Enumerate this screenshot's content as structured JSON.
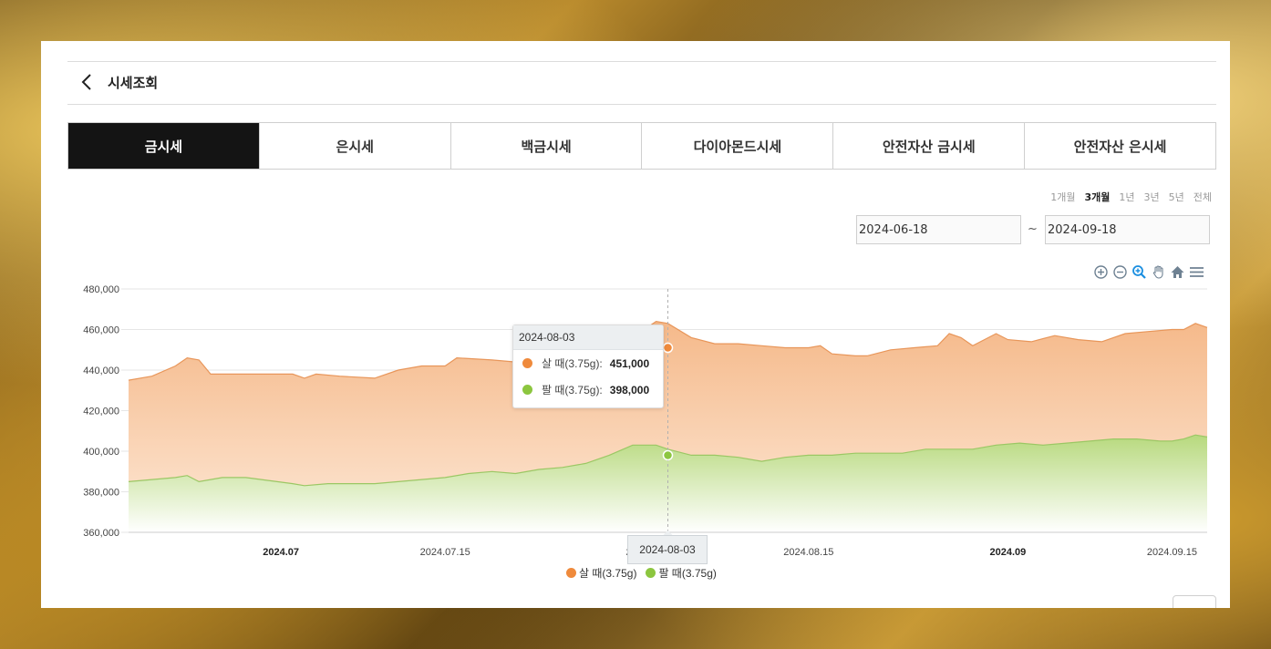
{
  "header": {
    "title": "시세조회"
  },
  "tabs": [
    {
      "label": "금시세",
      "active": true
    },
    {
      "label": "은시세",
      "active": false
    },
    {
      "label": "백금시세",
      "active": false
    },
    {
      "label": "다이아몬드시세",
      "active": false
    },
    {
      "label": "안전자산 금시세",
      "active": false
    },
    {
      "label": "안전자산 은시세",
      "active": false
    }
  ],
  "periods": [
    {
      "label": "1개월",
      "active": false
    },
    {
      "label": "3개월",
      "active": true
    },
    {
      "label": "1년",
      "active": false
    },
    {
      "label": "3년",
      "active": false
    },
    {
      "label": "5년",
      "active": false
    },
    {
      "label": "전체",
      "active": false
    }
  ],
  "date_range": {
    "start": "2024-06-18",
    "separator": "~",
    "end": "2024-09-18"
  },
  "toolbar_icons": [
    "zoom-in-icon",
    "zoom-out-icon",
    "selection-zoom-icon",
    "pan-hand-icon",
    "home-reset-icon",
    "menu-icon"
  ],
  "colors": {
    "buy": "#ef8a3c",
    "sell": "#8cc63f",
    "active_tab": "#141414"
  },
  "tooltip": {
    "date": "2024-08-03",
    "rows": [
      {
        "label": "살 때(3.75g):",
        "value": "451,000",
        "color": "#ef8a3c"
      },
      {
        "label": "팔 때(3.75g):",
        "value": "398,000",
        "color": "#8cc63f"
      }
    ]
  },
  "crosshair_label": "2024-08-03",
  "chart_data": {
    "type": "area",
    "x_start": "2024-06-18",
    "x_end": "2024-09-18",
    "x_ticks": [
      {
        "label": "2024.07",
        "date": "2024-07-01",
        "bold": true
      },
      {
        "label": "2024.07.15",
        "date": "2024-07-15",
        "bold": false
      },
      {
        "label": "2024.08",
        "date": "2024-08-01",
        "bold": true
      },
      {
        "label": "2024.08.15",
        "date": "2024-08-15",
        "bold": false
      },
      {
        "label": "2024.09",
        "date": "2024-09-01",
        "bold": true
      },
      {
        "label": "2024.09.15",
        "date": "2024-09-15",
        "bold": false
      }
    ],
    "y_ticks": [
      "480,000",
      "460,000",
      "440,000",
      "420,000",
      "400,000",
      "380,000",
      "360,000"
    ],
    "ylim": [
      360000,
      480000
    ],
    "grid": true,
    "legend": "bottom",
    "series": [
      {
        "name": "살 때(3.75g)",
        "color": "#ef8a3c",
        "points": [
          [
            "2024-06-18",
            435000
          ],
          [
            "2024-06-20",
            437000
          ],
          [
            "2024-06-22",
            442000
          ],
          [
            "2024-06-23",
            446000
          ],
          [
            "2024-06-24",
            445000
          ],
          [
            "2024-06-25",
            438000
          ],
          [
            "2024-06-28",
            438000
          ],
          [
            "2024-07-02",
            438000
          ],
          [
            "2024-07-03",
            436000
          ],
          [
            "2024-07-04",
            438000
          ],
          [
            "2024-07-06",
            437000
          ],
          [
            "2024-07-09",
            436000
          ],
          [
            "2024-07-11",
            440000
          ],
          [
            "2024-07-13",
            442000
          ],
          [
            "2024-07-15",
            442000
          ],
          [
            "2024-07-16",
            446000
          ],
          [
            "2024-07-19",
            445000
          ],
          [
            "2024-07-21",
            444000
          ],
          [
            "2024-07-24",
            444000
          ],
          [
            "2024-07-26",
            450000
          ],
          [
            "2024-07-28",
            450000
          ],
          [
            "2024-07-30",
            452000
          ],
          [
            "2024-07-31",
            456000
          ],
          [
            "2024-08-02",
            464000
          ],
          [
            "2024-08-03",
            463000
          ],
          [
            "2024-08-05",
            456000
          ],
          [
            "2024-08-07",
            453000
          ],
          [
            "2024-08-09",
            453000
          ],
          [
            "2024-08-11",
            452000
          ],
          [
            "2024-08-13",
            451000
          ],
          [
            "2024-08-15",
            451000
          ],
          [
            "2024-08-16",
            452000
          ],
          [
            "2024-08-17",
            448000
          ],
          [
            "2024-08-19",
            447000
          ],
          [
            "2024-08-20",
            447000
          ],
          [
            "2024-08-22",
            450000
          ],
          [
            "2024-08-24",
            451000
          ],
          [
            "2024-08-26",
            452000
          ],
          [
            "2024-08-27",
            458000
          ],
          [
            "2024-08-28",
            456000
          ],
          [
            "2024-08-29",
            452000
          ],
          [
            "2024-08-30",
            455000
          ],
          [
            "2024-08-31",
            458000
          ],
          [
            "2024-09-01",
            455000
          ],
          [
            "2024-09-03",
            454000
          ],
          [
            "2024-09-05",
            457000
          ],
          [
            "2024-09-07",
            455000
          ],
          [
            "2024-09-09",
            454000
          ],
          [
            "2024-09-11",
            458000
          ],
          [
            "2024-09-13",
            459000
          ],
          [
            "2024-09-15",
            460000
          ],
          [
            "2024-09-16",
            460000
          ],
          [
            "2024-09-17",
            463000
          ],
          [
            "2024-09-18",
            461000
          ]
        ]
      },
      {
        "name": "팔 때(3.75g)",
        "color": "#8cc63f",
        "points": [
          [
            "2024-06-18",
            385000
          ],
          [
            "2024-06-20",
            386000
          ],
          [
            "2024-06-22",
            387000
          ],
          [
            "2024-06-23",
            388000
          ],
          [
            "2024-06-24",
            385000
          ],
          [
            "2024-06-26",
            387000
          ],
          [
            "2024-06-28",
            387000
          ],
          [
            "2024-07-02",
            384000
          ],
          [
            "2024-07-03",
            383000
          ],
          [
            "2024-07-05",
            384000
          ],
          [
            "2024-07-09",
            384000
          ],
          [
            "2024-07-11",
            385000
          ],
          [
            "2024-07-13",
            386000
          ],
          [
            "2024-07-15",
            387000
          ],
          [
            "2024-07-17",
            389000
          ],
          [
            "2024-07-19",
            390000
          ],
          [
            "2024-07-21",
            389000
          ],
          [
            "2024-07-23",
            391000
          ],
          [
            "2024-07-25",
            392000
          ],
          [
            "2024-07-27",
            394000
          ],
          [
            "2024-07-29",
            398000
          ],
          [
            "2024-07-31",
            403000
          ],
          [
            "2024-08-02",
            403000
          ],
          [
            "2024-08-03",
            401000
          ],
          [
            "2024-08-05",
            398000
          ],
          [
            "2024-08-07",
            398000
          ],
          [
            "2024-08-09",
            397000
          ],
          [
            "2024-08-11",
            395000
          ],
          [
            "2024-08-13",
            397000
          ],
          [
            "2024-08-15",
            398000
          ],
          [
            "2024-08-17",
            398000
          ],
          [
            "2024-08-19",
            399000
          ],
          [
            "2024-08-21",
            399000
          ],
          [
            "2024-08-23",
            399000
          ],
          [
            "2024-08-25",
            401000
          ],
          [
            "2024-08-27",
            401000
          ],
          [
            "2024-08-29",
            401000
          ],
          [
            "2024-08-31",
            403000
          ],
          [
            "2024-09-02",
            404000
          ],
          [
            "2024-09-04",
            403000
          ],
          [
            "2024-09-06",
            404000
          ],
          [
            "2024-09-08",
            405000
          ],
          [
            "2024-09-10",
            406000
          ],
          [
            "2024-09-12",
            406000
          ],
          [
            "2024-09-14",
            405000
          ],
          [
            "2024-09-15",
            405000
          ],
          [
            "2024-09-16",
            406000
          ],
          [
            "2024-09-17",
            408000
          ],
          [
            "2024-09-18",
            407000
          ]
        ]
      }
    ]
  }
}
